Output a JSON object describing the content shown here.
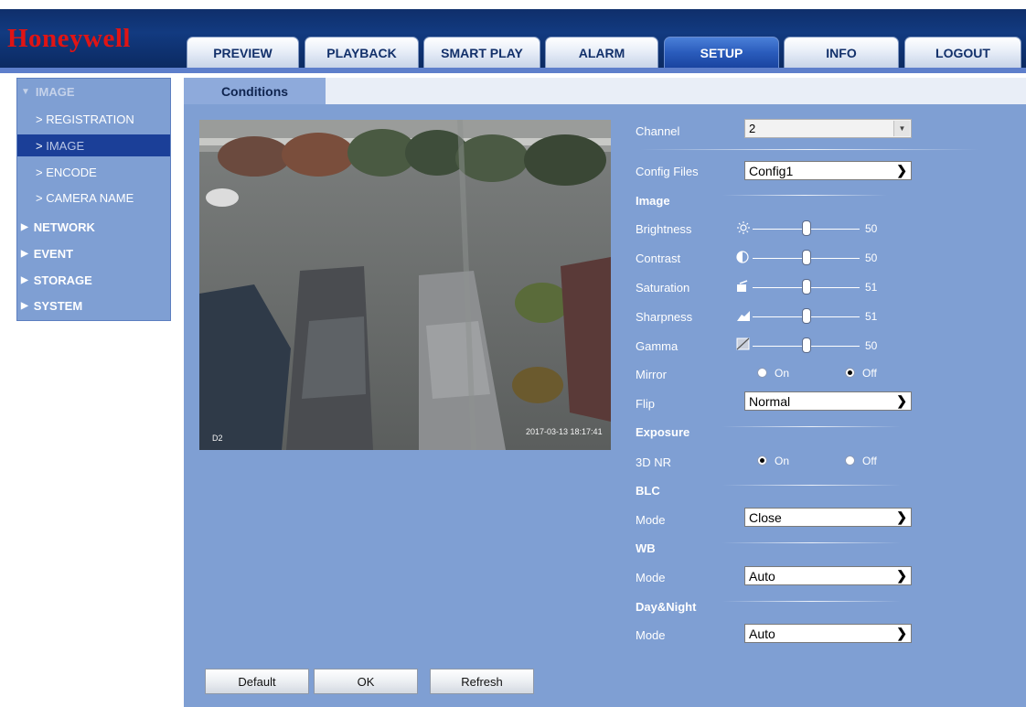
{
  "brand": "Honeywell",
  "nav": {
    "tabs": [
      "PREVIEW",
      "PLAYBACK",
      "SMART PLAY",
      "ALARM",
      "SETUP",
      "INFO",
      "LOGOUT"
    ],
    "active": "SETUP"
  },
  "sidebar": {
    "image_header": "IMAGE",
    "image_items": [
      "REGISTRATION",
      "IMAGE",
      "ENCODE",
      "CAMERA NAME"
    ],
    "selected": "IMAGE",
    "sections": [
      "NETWORK",
      "EVENT",
      "STORAGE",
      "SYSTEM"
    ]
  },
  "content_tab": "Conditions",
  "camera": {
    "timestamp": "2017-03-13 18:17:41",
    "channel_label": "D2"
  },
  "settings": {
    "channel": {
      "label": "Channel",
      "value": "2"
    },
    "config_files": {
      "label": "Config Files",
      "value": "Config1"
    },
    "image": {
      "title": "Image",
      "brightness": {
        "label": "Brightness",
        "value": 50,
        "icon": "brightness-icon"
      },
      "contrast": {
        "label": "Contrast",
        "value": 50,
        "icon": "contrast-icon"
      },
      "saturation": {
        "label": "Saturation",
        "value": 51,
        "icon": "saturation-icon"
      },
      "sharpness": {
        "label": "Sharpness",
        "value": 51,
        "icon": "sharpness-icon"
      },
      "gamma": {
        "label": "Gamma",
        "value": 50,
        "icon": "gamma-icon"
      },
      "mirror": {
        "label": "Mirror",
        "on_label": "On",
        "off_label": "Off",
        "selected": "Off"
      },
      "flip": {
        "label": "Flip",
        "value": "Normal"
      }
    },
    "exposure": {
      "title": "Exposure",
      "nr3d": {
        "label": "3D NR",
        "on_label": "On",
        "off_label": "Off",
        "selected": "On"
      }
    },
    "blc": {
      "title": "BLC",
      "mode": {
        "label": "Mode",
        "value": "Close"
      }
    },
    "wb": {
      "title": "WB",
      "mode": {
        "label": "Mode",
        "value": "Auto"
      }
    },
    "daynight": {
      "title": "Day&Night",
      "mode": {
        "label": "Mode",
        "value": "Auto"
      }
    }
  },
  "buttons": {
    "default": "Default",
    "ok": "OK",
    "refresh": "Refresh"
  },
  "colors": {
    "panel": "#7f9fd3",
    "nav_dark": "#123a80",
    "selected": "#1b3f98",
    "brand_red": "#e01414"
  }
}
